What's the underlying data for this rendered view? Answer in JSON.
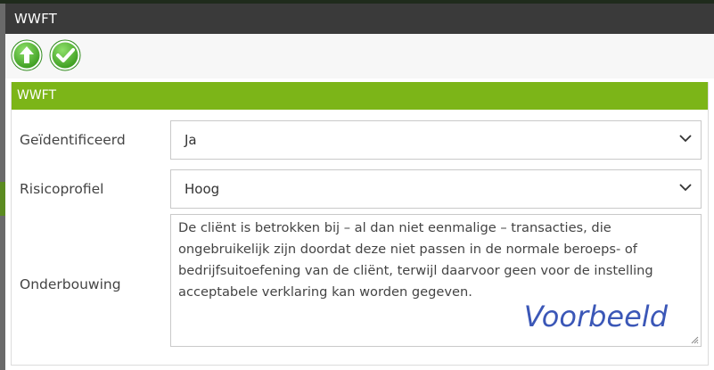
{
  "window": {
    "title": "WWFT"
  },
  "toolbar": {
    "buttons": [
      {
        "name": "up-arrow-icon",
        "color": "#5bb535"
      },
      {
        "name": "checkmark-icon",
        "color": "#5bb535"
      }
    ]
  },
  "section": {
    "title": "WWFT",
    "accent_color": "#7cb518"
  },
  "form": {
    "identified": {
      "label": "Geïdentificeerd",
      "value": "Ja"
    },
    "risk_profile": {
      "label": "Risicoprofiel",
      "value": "Hoog"
    },
    "justification": {
      "label": "Onderbouwing",
      "value": "De cliënt is betrokken bij – al dan niet eenmalige – transacties, die ongebruikelijk zijn doordat deze niet passen in de normale beroeps- of bedrijfsuitoefening van de cliënt, terwijl daarvoor geen voor de instelling acceptabele verklaring kan worden gegeven.",
      "watermark": "Voorbeeld"
    }
  }
}
